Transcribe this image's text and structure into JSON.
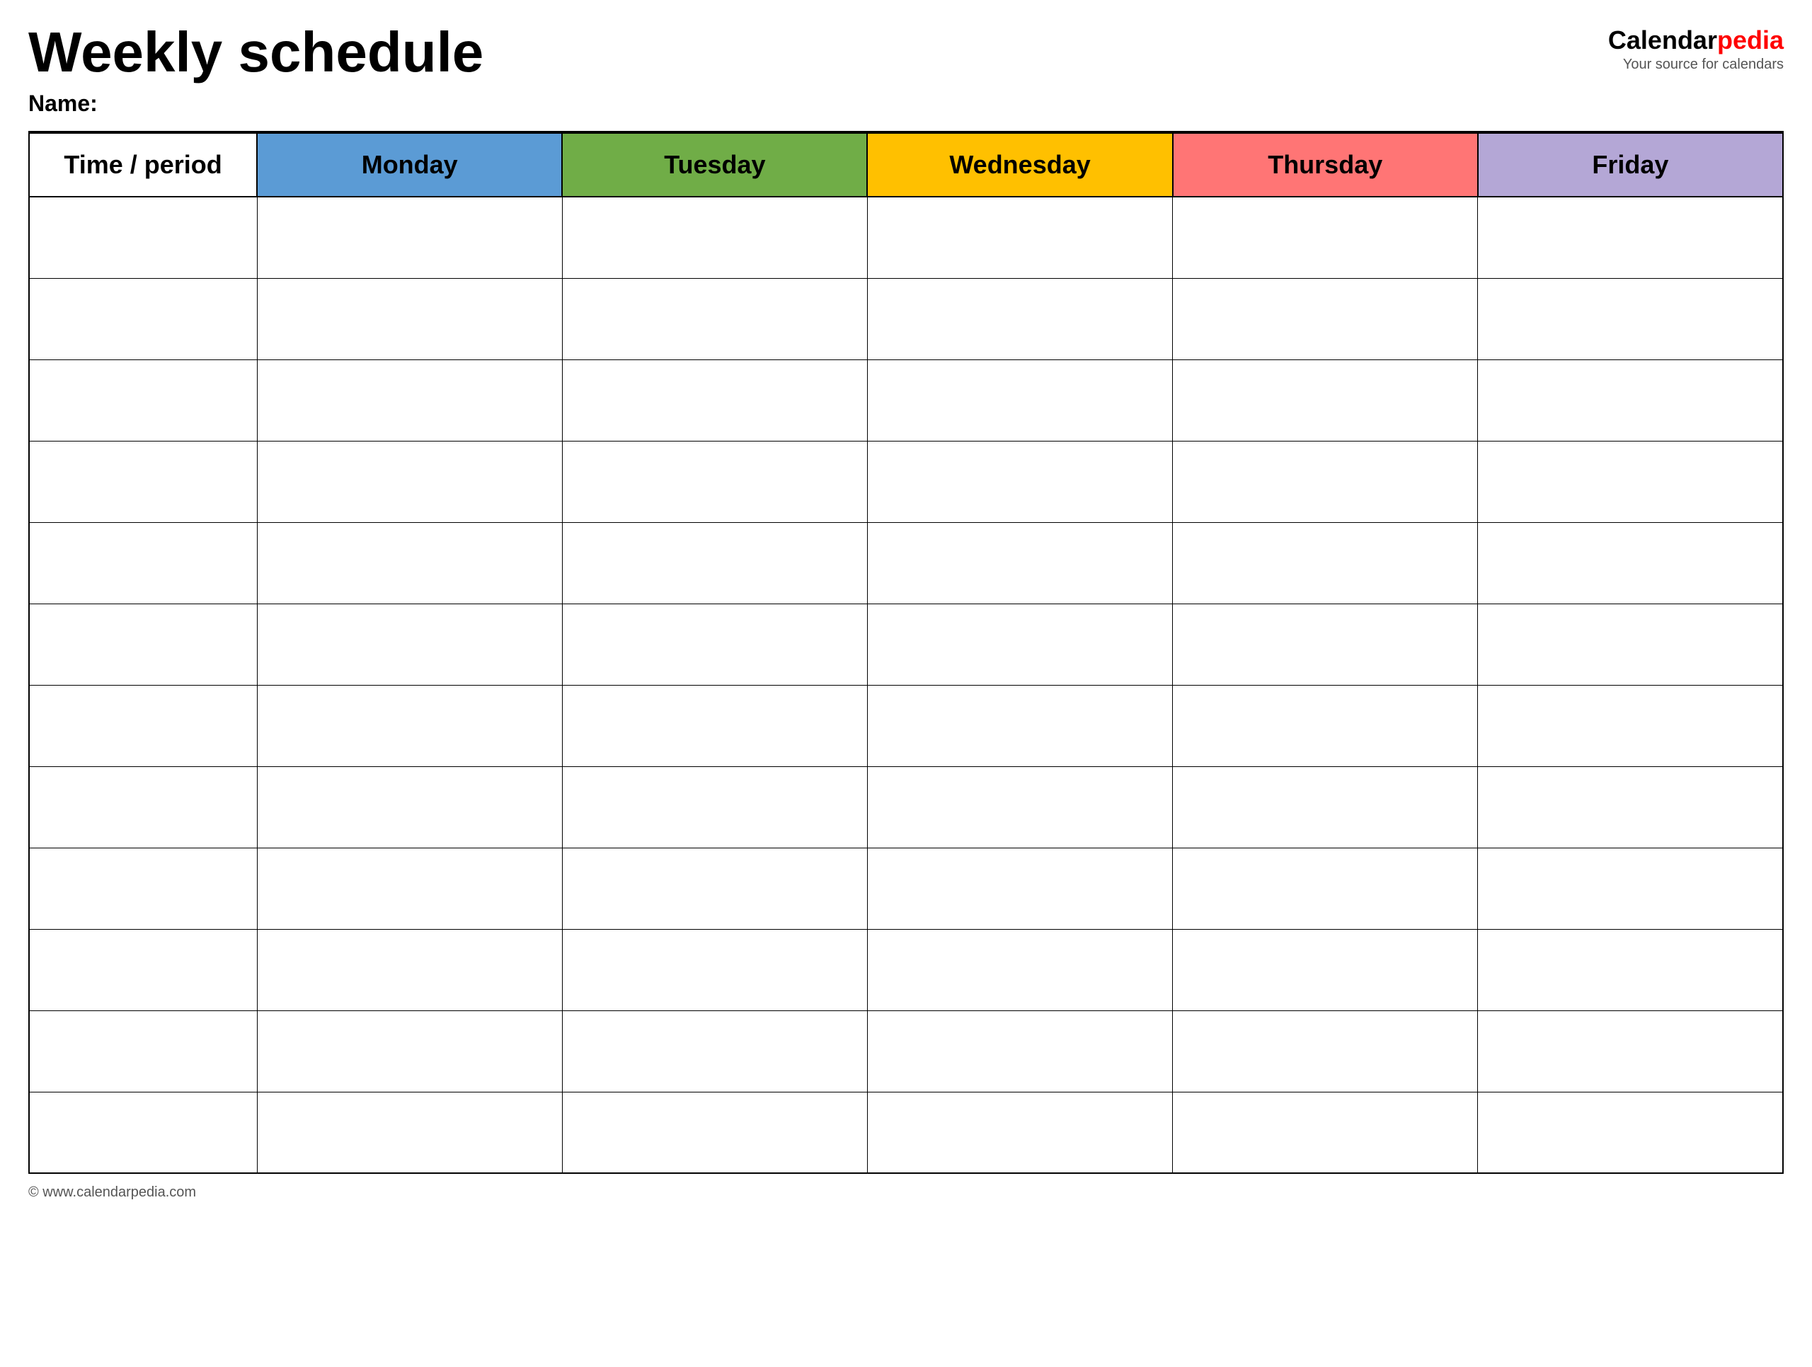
{
  "header": {
    "title": "Weekly schedule",
    "name_label": "Name:",
    "logo_calendar": "Calendar",
    "logo_pedia": "pedia",
    "logo_tagline": "Your source for calendars"
  },
  "table": {
    "columns": [
      {
        "id": "time",
        "label": "Time / period",
        "color_class": "col-time"
      },
      {
        "id": "monday",
        "label": "Monday",
        "color_class": "col-monday"
      },
      {
        "id": "tuesday",
        "label": "Tuesday",
        "color_class": "col-tuesday"
      },
      {
        "id": "wednesday",
        "label": "Wednesday",
        "color_class": "col-wednesday"
      },
      {
        "id": "thursday",
        "label": "Thursday",
        "color_class": "col-thursday"
      },
      {
        "id": "friday",
        "label": "Friday",
        "color_class": "col-friday"
      }
    ],
    "row_count": 12
  },
  "footer": {
    "url": "© www.calendarpedia.com"
  }
}
